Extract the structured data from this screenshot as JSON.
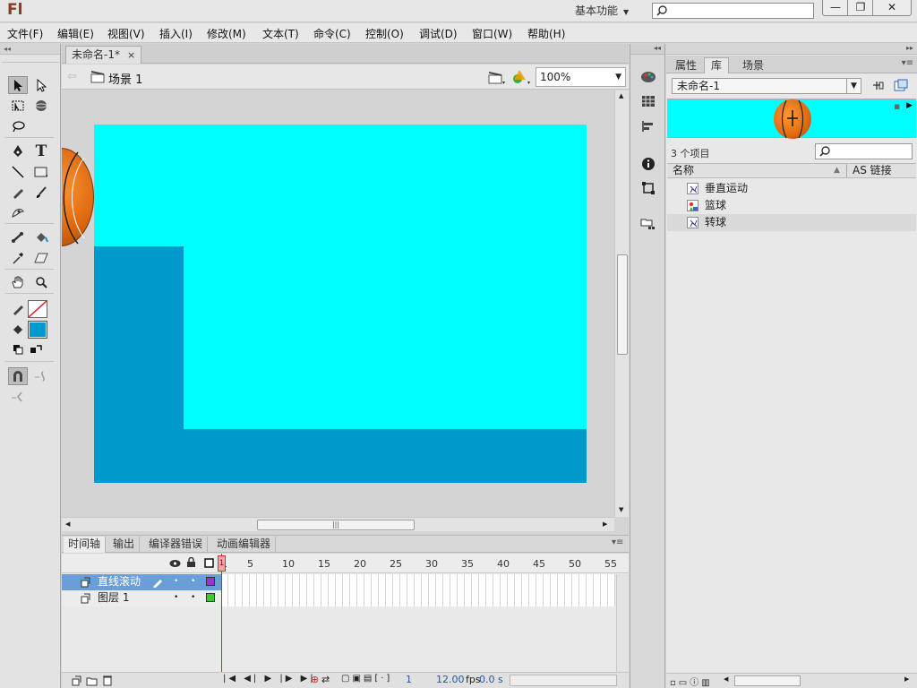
{
  "titlebar": {
    "logo": "Fl",
    "workspace": "基本功能",
    "min_label": "—",
    "max_label": "❐",
    "close_label": "✕"
  },
  "menu": [
    "文件(F)",
    "编辑(E)",
    "视图(V)",
    "插入(I)",
    "修改(M)",
    "文本(T)",
    "命令(C)",
    "控制(O)",
    "调试(D)",
    "窗口(W)",
    "帮助(H)"
  ],
  "document": {
    "tab_title": "未命名-1*",
    "close_glyph": "×",
    "scene": "场景 1",
    "zoom": "100%"
  },
  "timeline": {
    "tabs": [
      "时间轴",
      "输出",
      "编译器错误",
      "动画编辑器"
    ],
    "frame_numbers": [
      "1",
      "5",
      "10",
      "15",
      "20",
      "25",
      "30",
      "35",
      "40",
      "45",
      "50",
      "55"
    ],
    "layers": [
      {
        "name": "直线滚动",
        "selected": true,
        "color": "#9933cc"
      },
      {
        "name": "图层 1",
        "selected": false,
        "color": "#33cc33"
      }
    ],
    "footer": {
      "current_frame": "1",
      "fps": "12.00",
      "fps_unit": "fps",
      "time": "0.0 s"
    }
  },
  "panel": {
    "tabs": [
      "属性",
      "库",
      "场景"
    ],
    "active_tab": "库",
    "library_name": "未命名-1",
    "item_count": "3 个项目",
    "col_name": "名称",
    "col_linkage": "AS 链接",
    "items": [
      "垂直运动",
      "篮球",
      "转球"
    ]
  },
  "colors": {
    "stage": "#00ffff",
    "shape": "#0099cc",
    "fill_swatch": "#0099cc",
    "selection": "#6a9ed8"
  }
}
